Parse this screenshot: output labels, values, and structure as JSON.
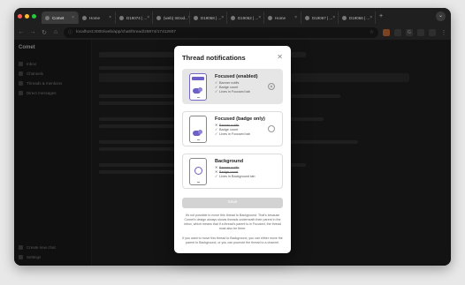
{
  "browser": {
    "tabs": [
      {
        "label": "Comet",
        "active": true
      },
      {
        "label": "Home",
        "active": false
      },
      {
        "label": "D19074 | ...",
        "active": false
      },
      {
        "label": "(web) Introd...",
        "active": false
      },
      {
        "label": "D19068 | ...",
        "active": false
      },
      {
        "label": "D19062 | ...",
        "active": false
      },
      {
        "label": "Home",
        "active": false
      },
      {
        "label": "D19067 | ...",
        "active": false
      },
      {
        "label": "D19066 | ...",
        "active": false
      }
    ],
    "url": "localhost:3000/web/app/chat/thread/29874/17412607",
    "traffic": {
      "red": "#ff5f57",
      "yellow": "#febc2e",
      "green": "#28c840"
    }
  },
  "app": {
    "brand": "Comet",
    "sidebar_items": [
      "Inbox",
      "Channels",
      "Threads & mentions",
      "Direct messages"
    ],
    "sidebar_bottom": [
      "Create new chat",
      "Settings"
    ]
  },
  "modal": {
    "title": "Thread notifications",
    "close_icon": "close-icon",
    "options": [
      {
        "title": "Focused (enabled)",
        "lines": [
          "Banner notifs",
          "Badge count",
          "Lives in Focused tab"
        ],
        "strike": [
          false,
          false,
          false
        ],
        "selected": true
      },
      {
        "title": "Focused (badge only)",
        "lines": [
          "Banner notifs",
          "Badge count",
          "Lives in Focused tab"
        ],
        "strike": [
          true,
          false,
          false
        ],
        "selected": false
      },
      {
        "title": "Background",
        "lines": [
          "Banner notifs",
          "Badge count",
          "Lives in Background tab"
        ],
        "strike": [
          true,
          true,
          false
        ],
        "selected": false
      }
    ],
    "save_label": "Save",
    "help_text_1": "It's not possible to move this thread to Background. That's because Comet's design always shows threads underneath their parent in the inbox, which means that if a thread's parent is in Focused, the thread must also be there.",
    "help_text_2": "If you want to move this thread to Background, you can either move the parent to Background, or you can promote the thread to a channel."
  },
  "colors": {
    "accent": "#6c5fc7",
    "save_disabled": "#d3d3d3"
  }
}
